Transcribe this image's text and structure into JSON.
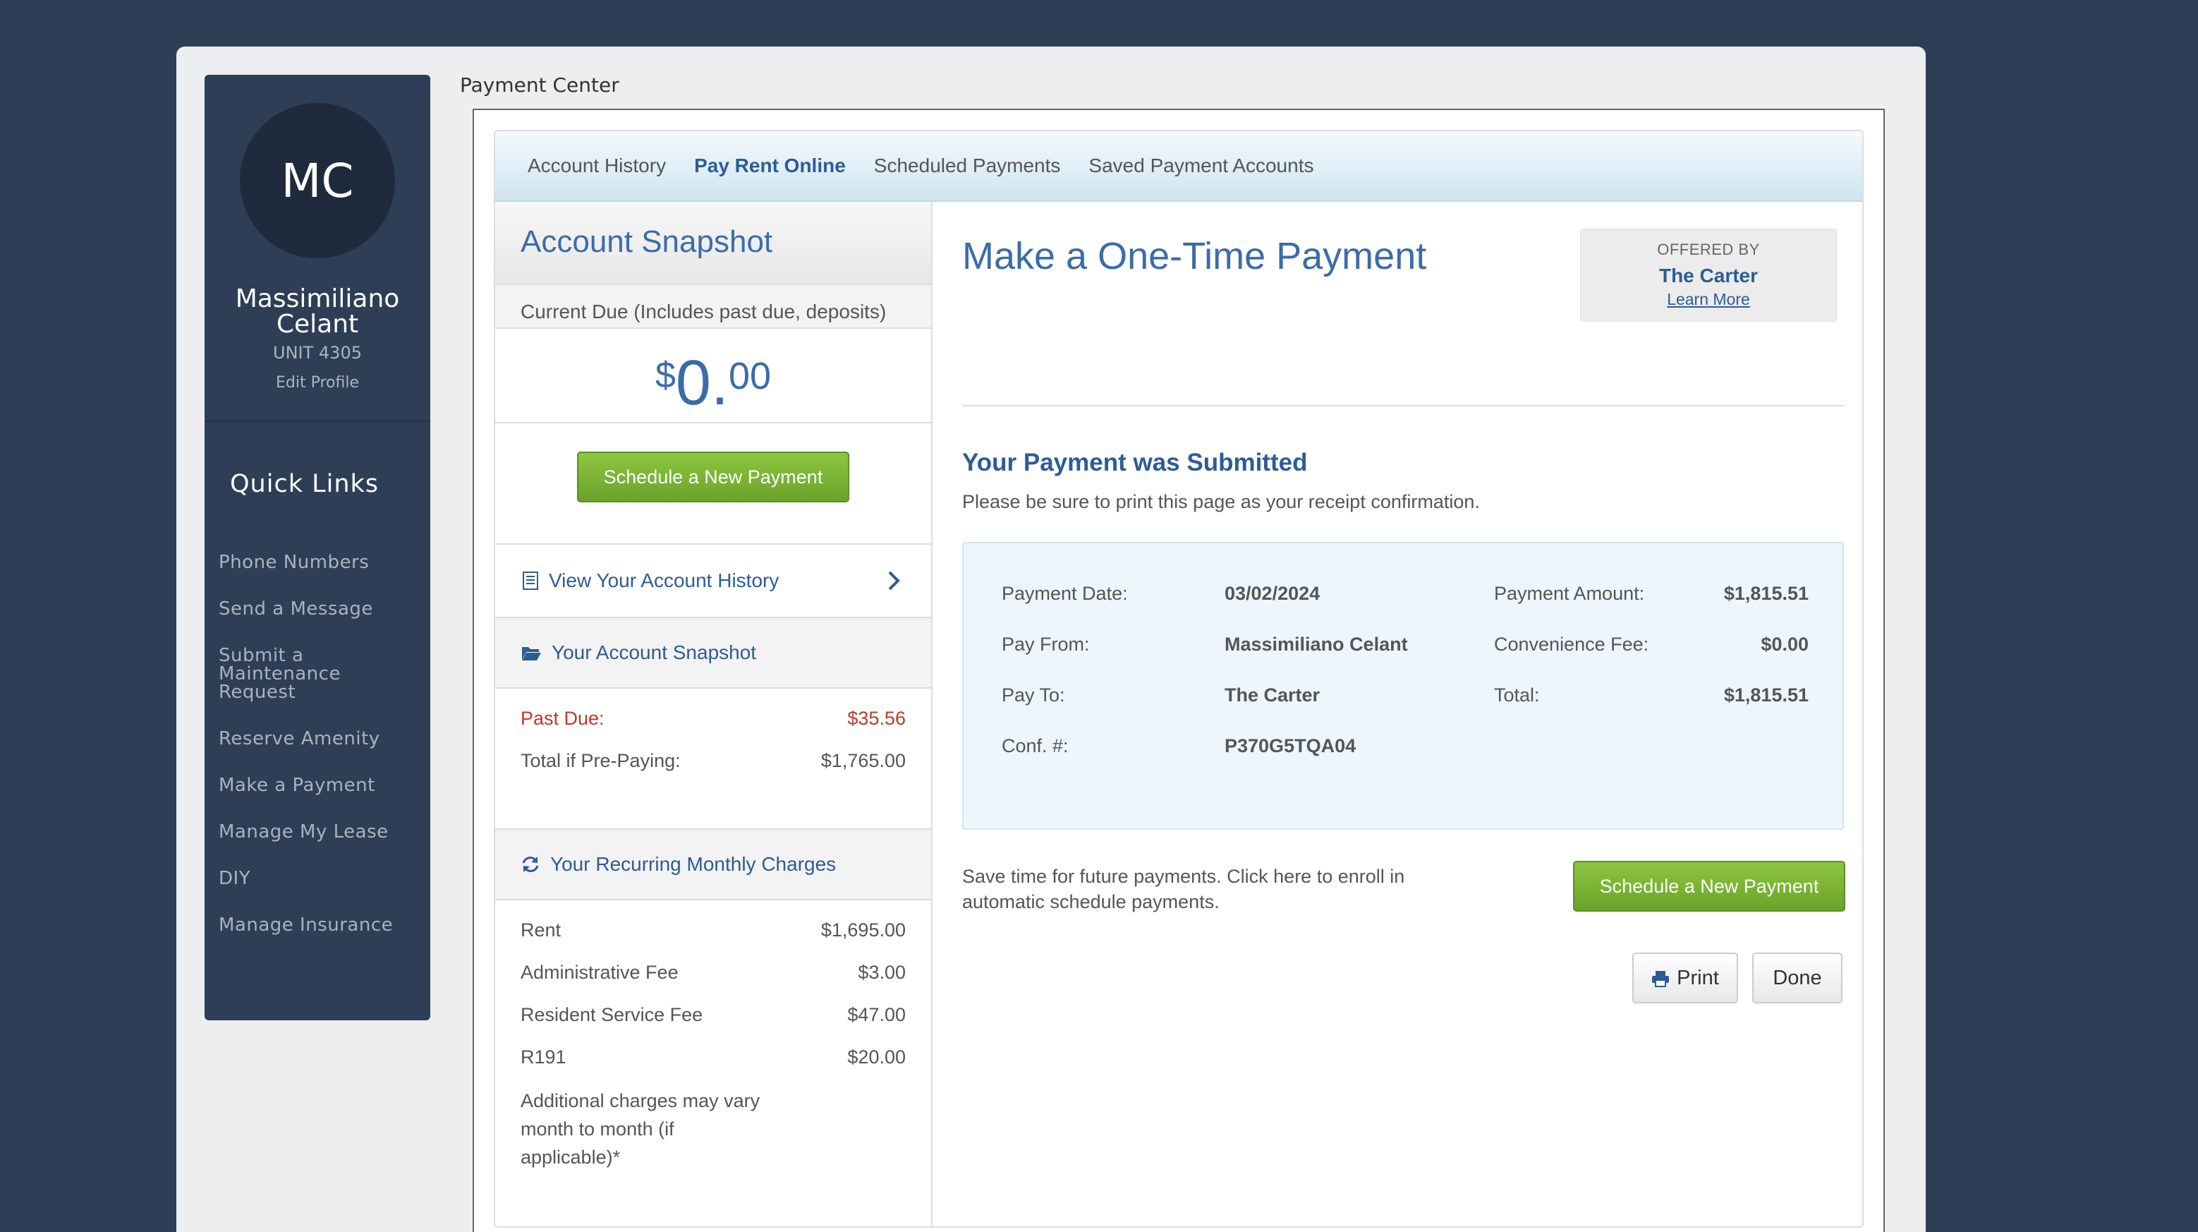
{
  "page_title": "Payment Center",
  "user": {
    "initials": "MC",
    "name": "Massimiliano Celant",
    "unit": "UNIT 4305",
    "edit_profile": "Edit Profile"
  },
  "quick_links": {
    "title": "Quick Links",
    "items": [
      "Phone Numbers",
      "Send a Message",
      "Submit a Maintenance Request",
      "Reserve Amenity",
      "Make a Payment",
      "Manage My Lease",
      "DIY",
      "Manage Insurance"
    ]
  },
  "tabs": [
    "Account History",
    "Pay Rent Online",
    "Scheduled Payments",
    "Saved Payment Accounts"
  ],
  "active_tab": "Pay Rent Online",
  "snapshot": {
    "title": "Account Snapshot",
    "current_due_label": "Current Due (Includes past due, deposits)",
    "amount_symbol": "$",
    "amount_whole": "0.",
    "amount_cents": "00",
    "schedule_button": "Schedule a New Payment",
    "view_history": "View Your Account History",
    "your_snapshot_title": "Your Account Snapshot",
    "past_due_label": "Past Due:",
    "past_due_value": "$35.56",
    "prepay_label": "Total if Pre-Paying:",
    "prepay_value": "$1,765.00"
  },
  "recurring": {
    "title": "Your Recurring Monthly Charges",
    "items": [
      {
        "label": "Rent",
        "value": "$1,695.00"
      },
      {
        "label": "Administrative Fee",
        "value": "$3.00"
      },
      {
        "label": "Resident Service Fee",
        "value": "$47.00"
      },
      {
        "label": "R191",
        "value": "$20.00"
      }
    ],
    "note": "Additional charges may vary month to month (if applicable)*"
  },
  "payment": {
    "title": "Make a One-Time Payment",
    "offered_by_label": "OFFERED BY",
    "offered_by_name": "The Carter",
    "learn_more": "Learn More",
    "submitted_title": "Your Payment was Submitted",
    "print_note": "Please be sure to print this page as your receipt confirmation.",
    "receipt": {
      "payment_date_label": "Payment Date:",
      "payment_date": "03/02/2024",
      "pay_from_label": "Pay From:",
      "pay_from": "Massimiliano Celant",
      "pay_to_label": "Pay To:",
      "pay_to": "The Carter",
      "conf_label": "Conf. #:",
      "conf": "P370G5TQA04",
      "payment_amount_label": "Payment Amount:",
      "payment_amount": "$1,815.51",
      "convenience_fee_label": "Convenience Fee:",
      "convenience_fee": "$0.00",
      "total_label": "Total:",
      "total": "$1,815.51"
    },
    "enroll_text": "Save time for future payments. Click here to enroll in automatic schedule payments.",
    "schedule_button": "Schedule a New Payment",
    "print_button": "Print",
    "done_button": "Done"
  },
  "colors": {
    "background": "#2e3e56",
    "accent_blue": "#2d5c95",
    "green": "#7ab536",
    "past_due_red": "#c0392b"
  }
}
